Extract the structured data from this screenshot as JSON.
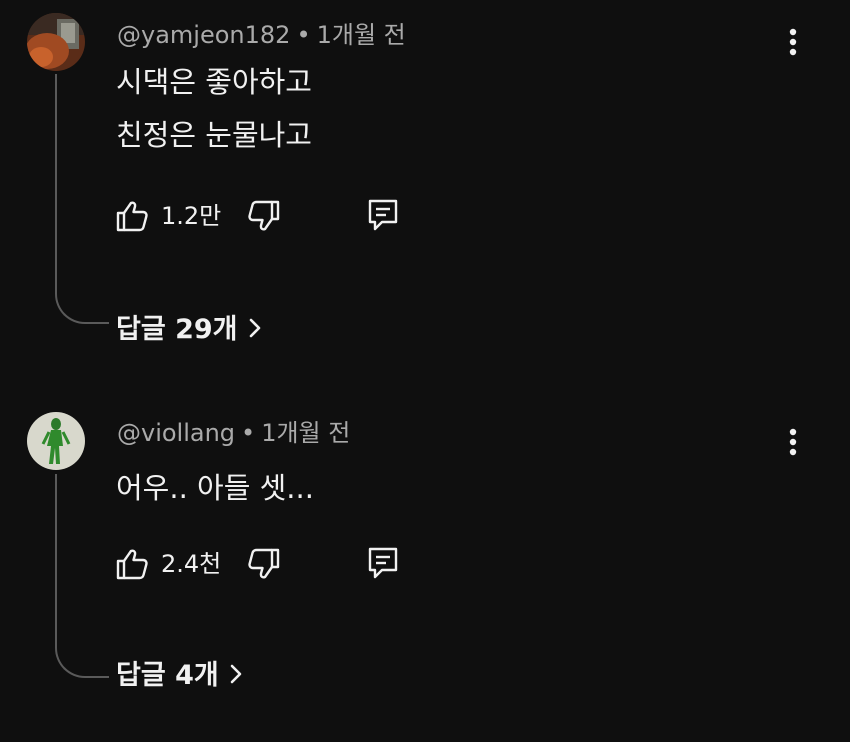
{
  "comments": [
    {
      "author": "@yamjeon182",
      "time": "1개월 전",
      "lines": [
        "시댁은 좋아하고",
        "친정은 눈물나고"
      ],
      "likes": "1.2만",
      "replies_label": "답글 29개"
    },
    {
      "author": "@viollang",
      "time": "1개월 전",
      "lines": [
        "어우.. 아들 셋..."
      ],
      "likes": "2.4천",
      "replies_label": "답글 4개"
    }
  ],
  "separator": "•",
  "colors": {
    "background": "#0f0f0f",
    "text": "#f1f1f1",
    "meta": "#aaaaaa",
    "thread_line": "#5a5a5a"
  },
  "icons": {
    "like": "thumbs-up-icon",
    "dislike": "thumbs-down-icon",
    "reply": "reply-comment-icon",
    "menu": "more-vertical-icon",
    "expand": "chevron-right-icon"
  }
}
